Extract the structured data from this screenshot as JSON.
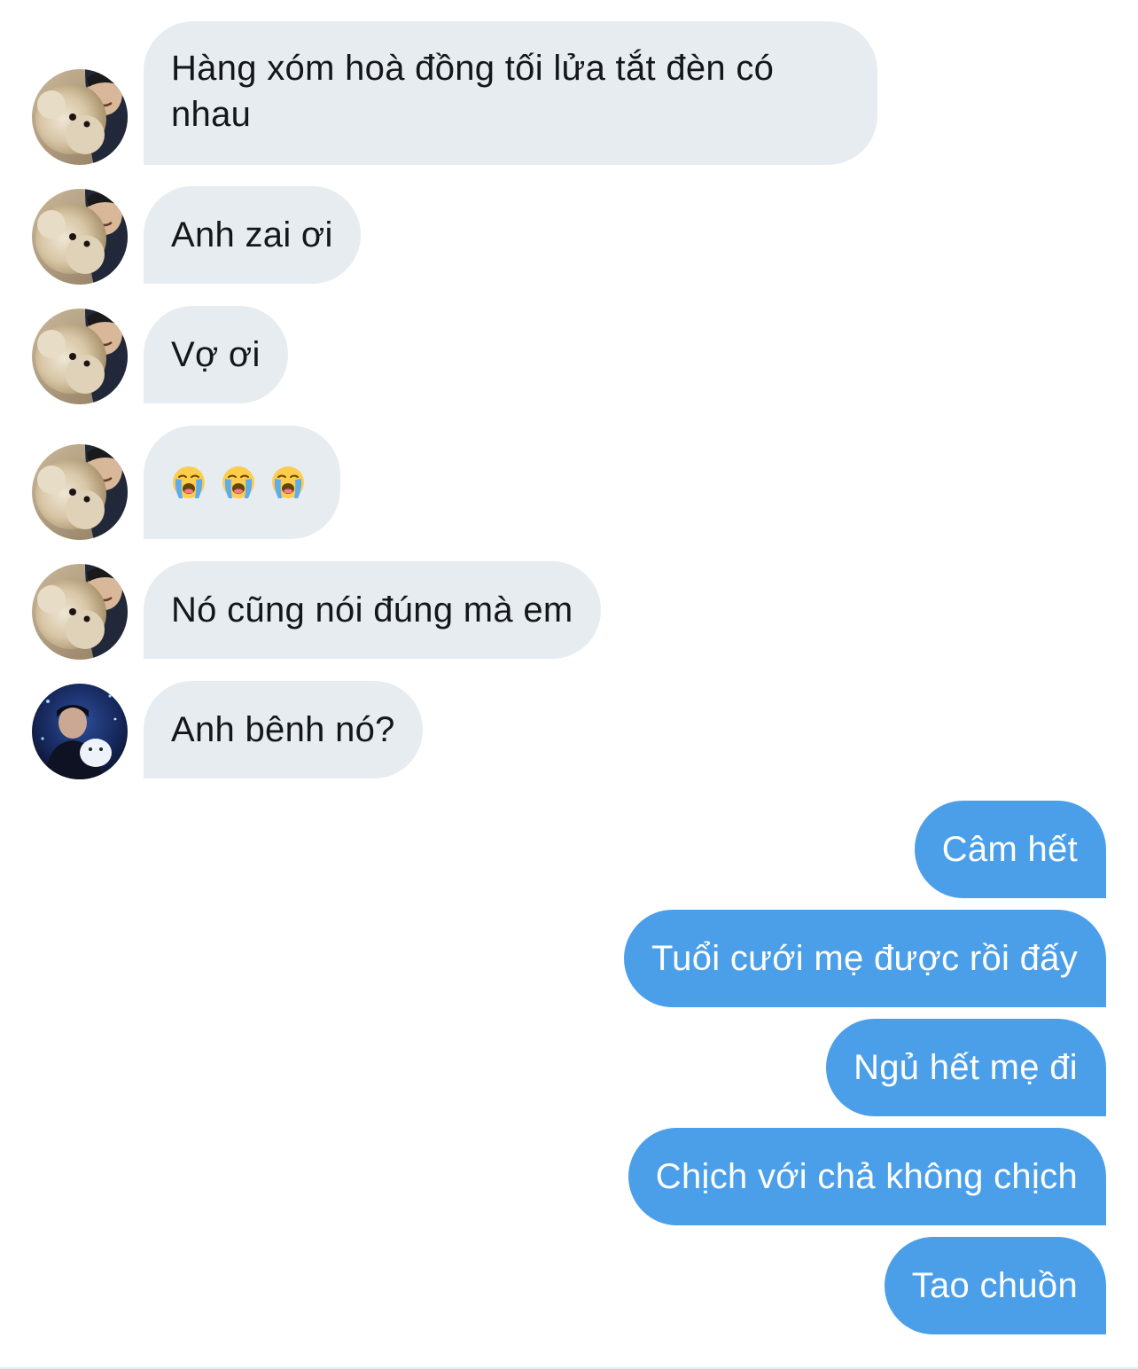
{
  "conversation": {
    "received": [
      {
        "text": "Hàng xóm hoà đồng tối lửa tắt đèn có nhau",
        "avatar": "pomeranian-selfie-avatar"
      },
      {
        "text": "Anh zai ơi",
        "avatar": "pomeranian-selfie-avatar"
      },
      {
        "text": "Vợ ơi",
        "avatar": "pomeranian-selfie-avatar"
      },
      {
        "text": "😭 😭 😭",
        "avatar": "pomeranian-selfie-avatar",
        "icon": "loudly-crying-face-icon"
      },
      {
        "text": "Nó cũng nói đúng mà em",
        "avatar": "pomeranian-selfie-avatar"
      },
      {
        "text": "Anh bênh nó?",
        "avatar": "night-blue-avatar"
      }
    ],
    "sent": [
      {
        "text": "Câm hết"
      },
      {
        "text": "Tuổi cưới mẹ được rồi đấy"
      },
      {
        "text": "Ngủ hết mẹ đi"
      },
      {
        "text": "Chịch với chả không chịch"
      },
      {
        "text": "Tao chuồn"
      }
    ]
  },
  "colors": {
    "received_bubble": "#e6ecf0",
    "sent_bubble": "#4b9fe9",
    "received_text": "#14171a",
    "sent_text": "#ffffff"
  }
}
